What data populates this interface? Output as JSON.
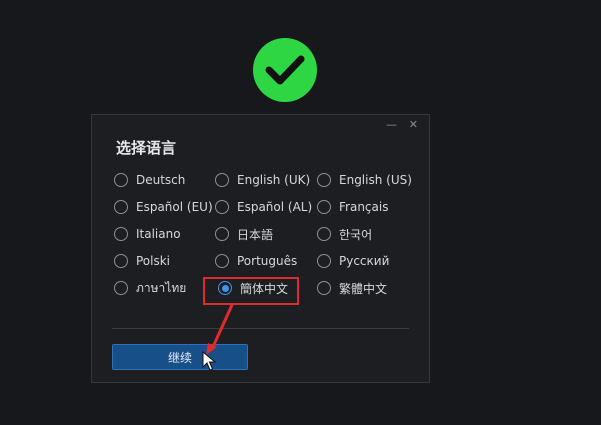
{
  "dialog": {
    "title": "选择语言",
    "minimize_glyph": "—",
    "close_glyph": "✕",
    "continue_label": "继续"
  },
  "languages": [
    {
      "label": "Deutsch",
      "selected": false
    },
    {
      "label": "English (UK)",
      "selected": false
    },
    {
      "label": "English (US)",
      "selected": false
    },
    {
      "label": "Español (EU)",
      "selected": false
    },
    {
      "label": "Español (AL)",
      "selected": false
    },
    {
      "label": "Français",
      "selected": false
    },
    {
      "label": "Italiano",
      "selected": false
    },
    {
      "label": "日本語",
      "selected": false
    },
    {
      "label": "한국어",
      "selected": false
    },
    {
      "label": "Polski",
      "selected": false
    },
    {
      "label": "Português",
      "selected": false
    },
    {
      "label": "Русский",
      "selected": false
    },
    {
      "label": "ภาษาไทย",
      "selected": false
    },
    {
      "label": "簡体中文",
      "selected": true
    },
    {
      "label": "繁體中文",
      "selected": false
    }
  ],
  "colors": {
    "background": "#17181b",
    "dialog_bg": "#1d1e22",
    "success_green": "#2fd644",
    "accent_blue": "#3f94ee",
    "button_bg": "#174f89",
    "annotation_red": "#e02b2b"
  },
  "icons": {
    "status": "check-circle-icon",
    "pointer": "mouse-cursor-icon",
    "annotation": "red-arrow-icon"
  }
}
